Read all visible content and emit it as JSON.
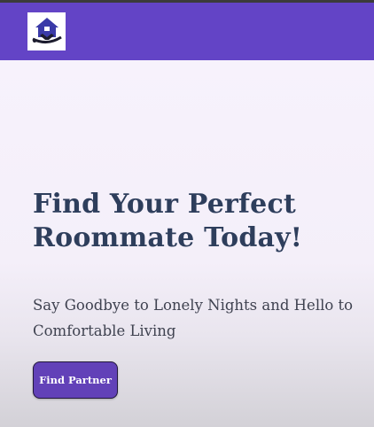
{
  "header": {
    "logo_icon": "house-handshake-logo-icon",
    "background_color": "#6344c6"
  },
  "hero": {
    "headline": "Find Your Perfect Roommate Today!",
    "subheadline": "Say Goodbye to Lonely Nights and Hello to Comfortable Living",
    "cta_label": "Find Partner",
    "cta_color": "#6241b8"
  }
}
